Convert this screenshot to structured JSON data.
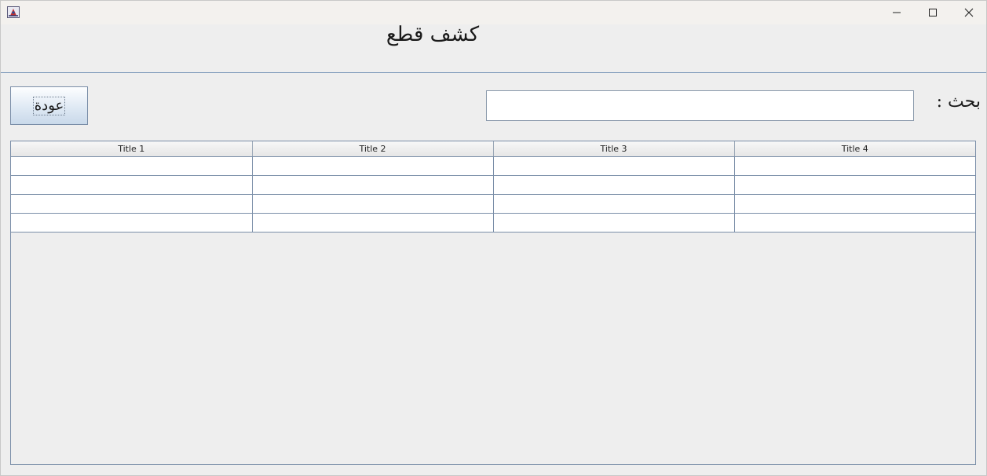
{
  "window": {
    "title": "",
    "controls": {
      "minimize": "minimize-icon",
      "maximize": "maximize-icon",
      "close": "close-icon"
    }
  },
  "header": {
    "title": "كشف قطع"
  },
  "toolbar": {
    "back_label": "عودة",
    "search_label": "بحث :",
    "search_value": ""
  },
  "table": {
    "columns": [
      "Title 1",
      "Title 2",
      "Title 3",
      "Title 4"
    ],
    "rows": [
      [
        "",
        "",
        "",
        ""
      ],
      [
        "",
        "",
        "",
        ""
      ],
      [
        "",
        "",
        "",
        ""
      ],
      [
        "",
        "",
        "",
        ""
      ]
    ]
  },
  "colors": {
    "background": "#eeeeee",
    "border": "#7a8ea8",
    "titlebar": "#f3f1ee"
  }
}
